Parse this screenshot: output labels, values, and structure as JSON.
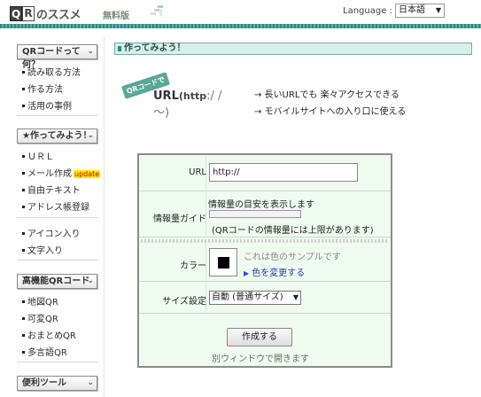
{
  "header": {
    "logo_q": "Q",
    "logo_r": "R",
    "logo_text": "のススメ",
    "logo_free": "無料版",
    "language_label": "Language :",
    "language_value": "日本語"
  },
  "sidebar": {
    "sections": [
      {
        "title": "QRコードって何？",
        "items": [
          "読み取る方法",
          "作る方法",
          "活用の事例"
        ]
      },
      {
        "title": "★作ってみよう！",
        "items": [
          "ＵＲＬ",
          "メール作成",
          "自由テキスト",
          "アドレス帳登録"
        ],
        "badge": "update"
      },
      {
        "title": "",
        "items": [
          "アイコン入り",
          "文字入り"
        ]
      },
      {
        "title": "高機能QRコード",
        "items": [
          "地図QR",
          "可変QR",
          "おまとめQR",
          "多言語QR"
        ]
      },
      {
        "title": "便利ツール",
        "items": []
      }
    ]
  },
  "main": {
    "title": "作ってみよう！",
    "banner": {
      "badge": "QRコードで",
      "url_main": "URL",
      "url_http": "(http",
      "url_tail": ":/ / 〜)"
    },
    "bullets": [
      "→ 長いURLでも 楽々アクセスできる",
      "→ モバイルサイトへの入り口に使える"
    ]
  },
  "form": {
    "url_label": "URL",
    "url_value": "http://",
    "guide_label": "情報量ガイド",
    "guide_text": "情報量の目安を表示します",
    "guide_level": 0,
    "guide_note": "(QRコードの情報量には上限があります)",
    "color_label": "カラー",
    "color_sample_text": "これは色のサンプルです",
    "color_link": "色を変更する",
    "color_value": "#000000",
    "size_label": "サイズ設定",
    "size_value": "自動 (普通サイズ)",
    "create_button": "作成する",
    "create_note": "別ウィンドウで開きます"
  }
}
